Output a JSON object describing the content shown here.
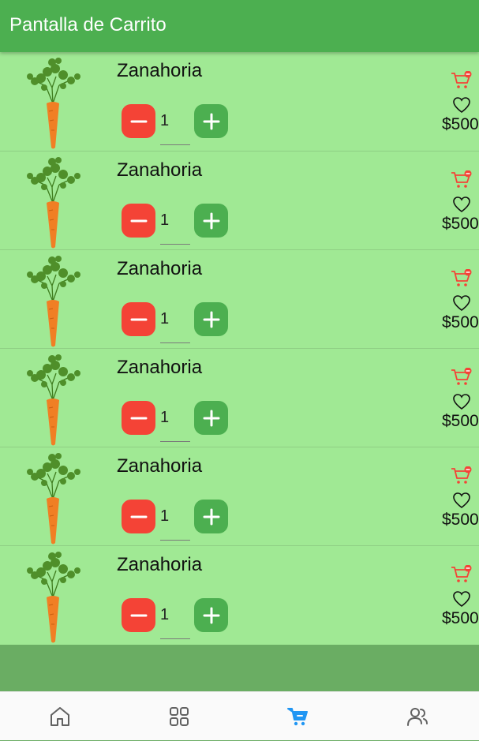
{
  "appbar": {
    "title": "Pantalla de Carrito"
  },
  "cart": {
    "items": [
      {
        "name": "Zanahoria",
        "quantity": "1",
        "price": "$500"
      },
      {
        "name": "Zanahoria",
        "quantity": "1",
        "price": "$500"
      },
      {
        "name": "Zanahoria",
        "quantity": "1",
        "price": "$500"
      },
      {
        "name": "Zanahoria",
        "quantity": "1",
        "price": "$500"
      },
      {
        "name": "Zanahoria",
        "quantity": "1",
        "price": "$500"
      },
      {
        "name": "Zanahoria",
        "quantity": "1",
        "price": "$500"
      }
    ]
  },
  "bottom_nav": {
    "items": [
      {
        "icon": "home-icon",
        "active": false
      },
      {
        "icon": "grid-icon",
        "active": false
      },
      {
        "icon": "cart-icon",
        "active": true
      },
      {
        "icon": "users-icon",
        "active": false
      }
    ]
  },
  "colors": {
    "appbar": "#4caf50",
    "list_background": "#a0e994",
    "minus_button": "#f44336",
    "plus_button": "#4caf50",
    "remove_icon": "#f44336",
    "nav_active": "#2196f3",
    "nav_inactive": "#616161"
  }
}
